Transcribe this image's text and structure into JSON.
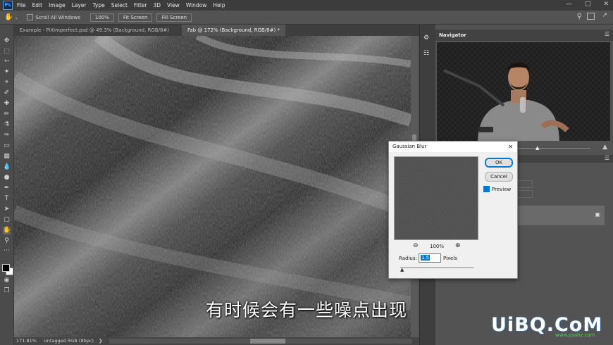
{
  "menubar": {
    "app_icon": "Ps",
    "items": [
      "File",
      "Edit",
      "Image",
      "Layer",
      "Type",
      "Select",
      "Filter",
      "3D",
      "View",
      "Window",
      "Help"
    ]
  },
  "options": {
    "scroll_all_label": "Scroll All Windows",
    "zoom_btn": "100%",
    "fit_btn": "Fit Screen",
    "fill_btn": "Fill Screen"
  },
  "tabs": [
    {
      "label": "Example - PiXimperfect.psd @ 49.3% (Background, RGB/8#)",
      "active": false
    },
    {
      "label": "Fab @ 172% (Background, RGB/8#) *",
      "active": true
    }
  ],
  "status": {
    "zoom": "171.81%",
    "profile": "Untagged RGB (8bpc)"
  },
  "navigator": {
    "title": "Navigator"
  },
  "dialog": {
    "title": "Gaussian Blur",
    "ok": "OK",
    "cancel": "Cancel",
    "preview_label": "Preview",
    "preview_checked": true,
    "zoom": "100%",
    "radius_label": "Radius:",
    "radius_value": "1.5",
    "unit": "Pixels"
  },
  "subtitle": "有时候会有一些噪点出现",
  "watermark": {
    "main": "UiBQ.CoM",
    "sub": "www.psahz.com"
  },
  "colors": {
    "accent": "#31a8ff",
    "dialog_bg": "#f0f0f0"
  }
}
